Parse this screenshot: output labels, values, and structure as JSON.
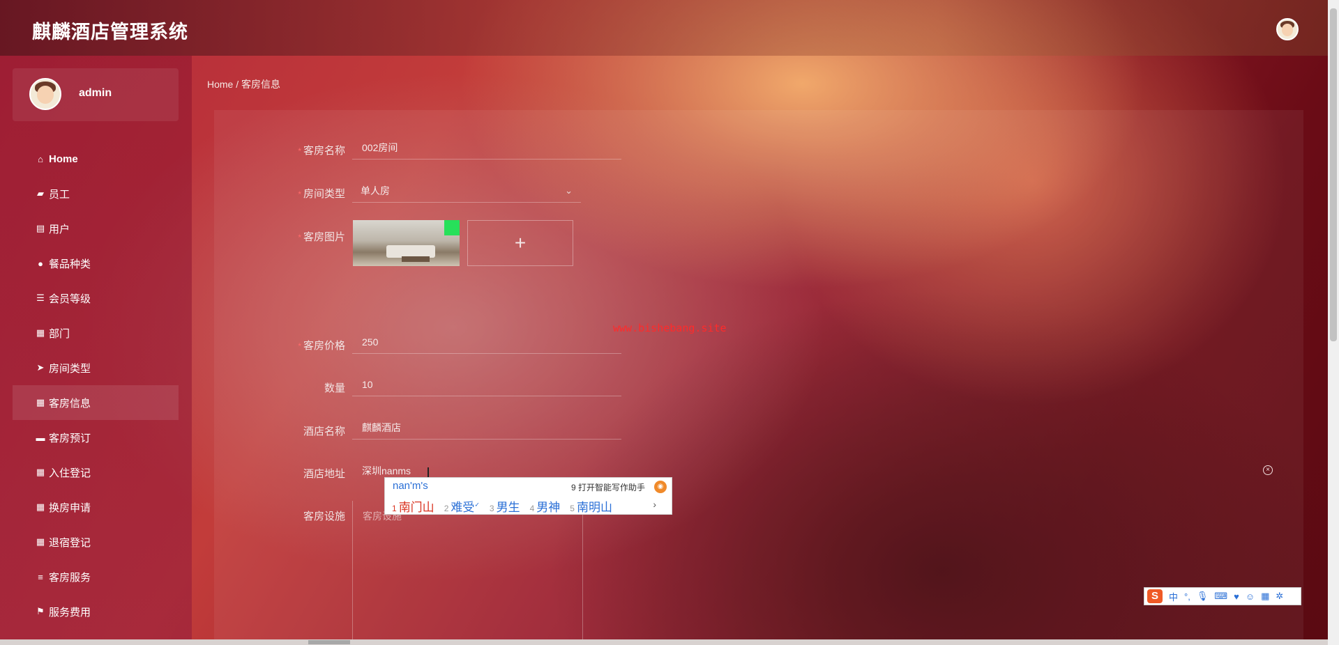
{
  "app": {
    "title": "麒麟酒店管理系统"
  },
  "user": {
    "name": "admin"
  },
  "sidebar": {
    "items": [
      {
        "label": "Home",
        "icon": "home-icon"
      },
      {
        "label": "员工",
        "icon": "thumbs-up-icon"
      },
      {
        "label": "用户",
        "icon": "clipboard-icon"
      },
      {
        "label": "餐品种类",
        "icon": "user-icon"
      },
      {
        "label": "会员等级",
        "icon": "sliders-icon"
      },
      {
        "label": "部门",
        "icon": "grid-icon"
      },
      {
        "label": "房间类型",
        "icon": "paper-plane-icon"
      },
      {
        "label": "客房信息",
        "icon": "grid-icon",
        "active": true
      },
      {
        "label": "客房预订",
        "icon": "monitor-icon"
      },
      {
        "label": "入住登记",
        "icon": "table-icon"
      },
      {
        "label": "换房申请",
        "icon": "grid-icon"
      },
      {
        "label": "退宿登记",
        "icon": "grid-icon"
      },
      {
        "label": "客房服务",
        "icon": "list-icon"
      },
      {
        "label": "服务费用",
        "icon": "flag-icon"
      }
    ]
  },
  "breadcrumb": "Home / 客房信息",
  "form": {
    "room_name": {
      "label": "客房名称",
      "value": "002房间"
    },
    "room_type": {
      "label": "房间类型",
      "value": "单人房"
    },
    "room_image": {
      "label": "客房图片",
      "upload_symbol": "+"
    },
    "price": {
      "label": "客房价格",
      "value": "250"
    },
    "quantity": {
      "label": "数量",
      "value": "10"
    },
    "hotel_name": {
      "label": "酒店名称",
      "value": "麒麟酒店"
    },
    "hotel_address": {
      "label": "酒店地址",
      "value": "深圳nanms"
    },
    "facilities": {
      "label": "客房设施",
      "placeholder": "客房设施"
    }
  },
  "watermark": "www.bishebang.site",
  "ime": {
    "pinyin": "nan'm's",
    "assistant": "9 打开智能写作助手",
    "candidates": [
      {
        "n": "1",
        "text": "南门山"
      },
      {
        "n": "2",
        "text": "难受"
      },
      {
        "n": "3",
        "text": "男生"
      },
      {
        "n": "4",
        "text": "男神"
      },
      {
        "n": "5",
        "text": "南明山"
      }
    ],
    "next": "›",
    "toolbar_mode": "中",
    "toolbar_punct": "°,"
  },
  "colors": {
    "accent": "#b3283b",
    "required": "#ff6a6a",
    "watermark": "#ff2a2a",
    "ime_blue": "#2a6fd6",
    "ime_red": "#d9321f"
  }
}
